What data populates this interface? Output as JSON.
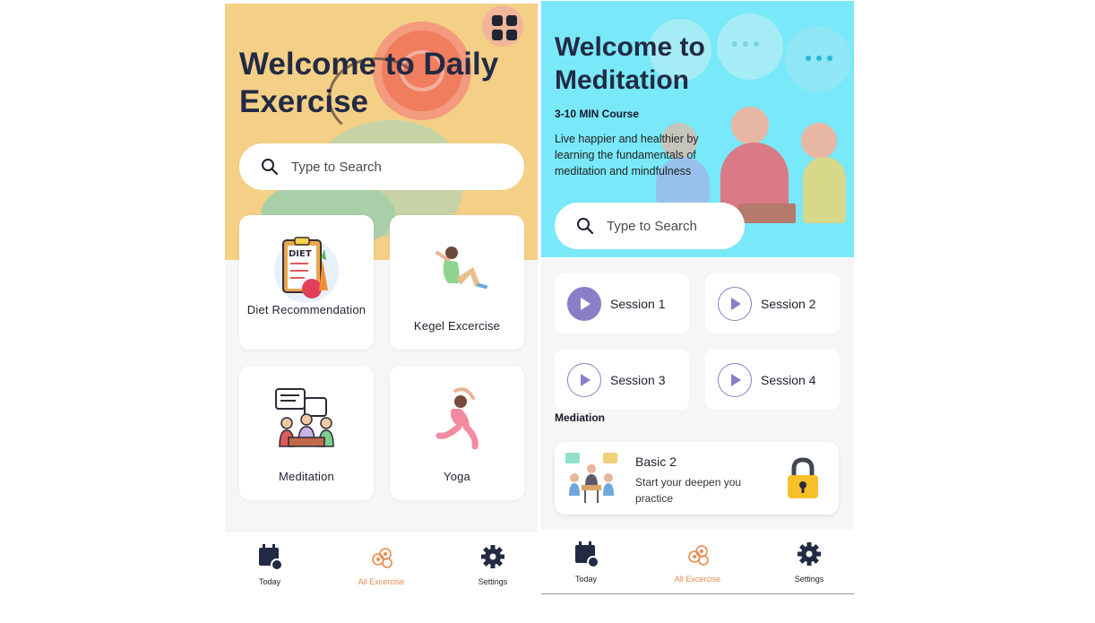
{
  "screen1": {
    "title": "Welcome to Daily Exercise",
    "search_placeholder": "Type to Search",
    "cards": [
      {
        "label": "Diet Recommendation",
        "icon": "diet-clipboard-icon"
      },
      {
        "label": "Kegel Excercise",
        "icon": "kegel-exercise-icon"
      },
      {
        "label": "Meditation",
        "icon": "meditation-group-icon"
      },
      {
        "label": "Yoga",
        "icon": "yoga-pose-icon"
      }
    ],
    "diet_badge": "DIET",
    "nav": [
      {
        "label": "Today",
        "icon": "calendar-icon"
      },
      {
        "label": "All Excercise",
        "icon": "exercise-icon"
      },
      {
        "label": "Settings",
        "icon": "gear-icon"
      }
    ]
  },
  "screen2": {
    "title": "Welcome to Meditation",
    "course": "3-10 MIN Course",
    "description": " Live happier and healthier by learning the fundamentals of meditation and mindfulness",
    "search_placeholder": "Type to Search",
    "sessions": [
      {
        "label": "Session 1",
        "active": true
      },
      {
        "label": "Session 2",
        "active": false
      },
      {
        "label": "Session 3",
        "active": false
      },
      {
        "label": "Session 4",
        "active": false
      }
    ],
    "section_label": "Mediation",
    "basic_card": {
      "title": "Basic 2",
      "subtitle": "Start your deepen you practice",
      "icon": "lock-icon"
    },
    "nav": [
      {
        "label": "Today",
        "icon": "calendar-icon"
      },
      {
        "label": "All Excercise",
        "icon": "exercise-icon"
      },
      {
        "label": "Settings",
        "icon": "gear-icon"
      }
    ]
  },
  "colors": {
    "hero1_bg": "#f4cf86",
    "hero2_bg": "#79e8f8",
    "accent_purple": "#8a7fc6",
    "active_nav": "#e78a4e",
    "title_text": "#222a44"
  }
}
